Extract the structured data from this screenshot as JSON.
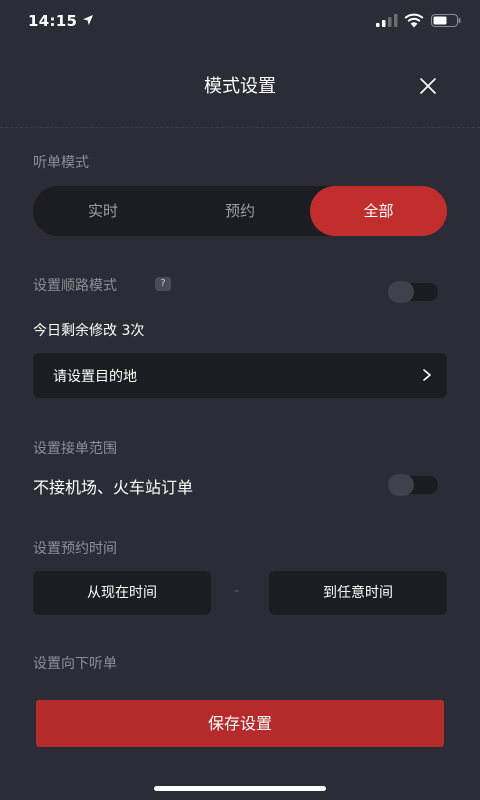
{
  "status_bar": {
    "time": "14:15"
  },
  "header": {
    "title": "模式设置"
  },
  "listen_mode": {
    "label": "听单模式",
    "options": [
      "实时",
      "预约",
      "全部"
    ],
    "selected": "全部"
  },
  "route_mode": {
    "label": "设置顺路模式",
    "help": "?",
    "toggle_on": false,
    "remaining_text": "今日剩余修改 3次",
    "destination_placeholder": "请设置目的地",
    "chevron": ">"
  },
  "range": {
    "label": "设置接单范围",
    "exclude_label": "不接机场、火车站订单",
    "toggle_on": false
  },
  "reservation_time": {
    "label": "设置预约时间",
    "from": "从现在时间",
    "separator": "-",
    "to": "到任意时间"
  },
  "downward": {
    "label": "设置向下听单"
  },
  "save_button": {
    "label": "保存设置"
  },
  "colors": {
    "background": "#2a2d35",
    "control_bg": "#1b1d23",
    "accent": "#c22e2e",
    "muted_text": "#8c8f97"
  },
  "icons": {
    "location": "location-arrow-icon",
    "signal": "signal-icon",
    "wifi": "wifi-icon",
    "battery": "battery-icon",
    "close": "close-icon",
    "chevron": "chevron-right-icon",
    "help": "help-icon"
  }
}
